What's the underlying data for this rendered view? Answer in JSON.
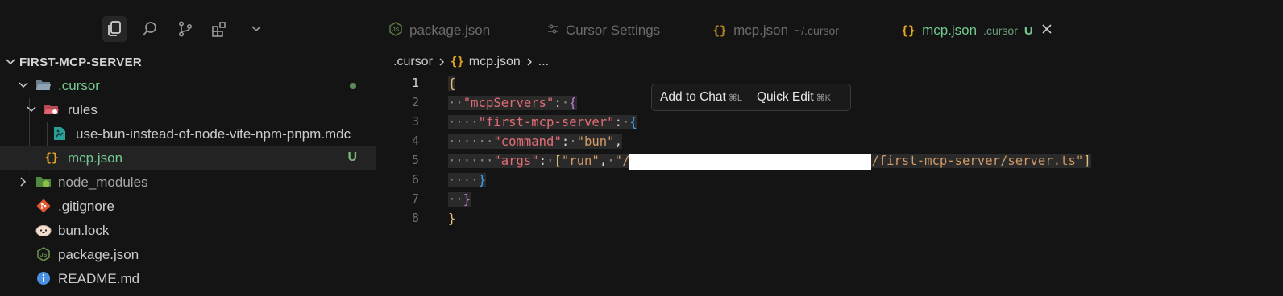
{
  "activity_bar": {
    "items": [
      "files-icon",
      "search-icon",
      "source-control-icon",
      "extensions-icon",
      "chevron-down-icon"
    ]
  },
  "explorer": {
    "root_title": "FIRST-MCP-SERVER",
    "items": [
      {
        "label": ".cursor",
        "status": "dot"
      },
      {
        "label": "rules"
      },
      {
        "label": "use-bun-instead-of-node-vite-npm-pnpm.mdc"
      },
      {
        "label": "mcp.json",
        "badge": "U"
      },
      {
        "label": "node_modules"
      },
      {
        "label": ".gitignore"
      },
      {
        "label": "bun.lock"
      },
      {
        "label": "package.json"
      },
      {
        "label": "README.md"
      }
    ]
  },
  "tabs": [
    {
      "label": "package.json",
      "description": "",
      "active": false
    },
    {
      "label": "Cursor Settings",
      "description": "",
      "active": false
    },
    {
      "label": "mcp.json",
      "description": "~/.cursor",
      "active": false
    },
    {
      "label": "mcp.json",
      "description": ".cursor",
      "badge": "U",
      "active": true
    }
  ],
  "breadcrumb": {
    "items": [
      ".cursor",
      "mcp.json",
      "..."
    ]
  },
  "editor": {
    "line_numbers": [
      "1",
      "2",
      "3",
      "4",
      "5",
      "6",
      "7",
      "8"
    ],
    "current_line": 1,
    "tokens": {
      "mcpServers_key": "\"mcpServers\"",
      "server_key": "\"first-mcp-server\"",
      "command_key": "\"command\"",
      "command_value": "\"bun\"",
      "args_key": "\"args\"",
      "arg_run": "\"run\"",
      "arg_path_prefix": "\"/",
      "arg_path_suffix": "/first-mcp-server/server.ts\""
    }
  },
  "popup": {
    "add_to_chat": "Add to Chat",
    "add_to_chat_shortcut": "⌘L",
    "quick_edit": "Quick Edit",
    "quick_edit_shortcut": "⌘K"
  },
  "colors": {
    "background": "#141414",
    "untracked_green": "#73c991",
    "json_brace_icon": "#e5a722",
    "string_key": "#e06c75",
    "string_value": "#d19a66"
  }
}
